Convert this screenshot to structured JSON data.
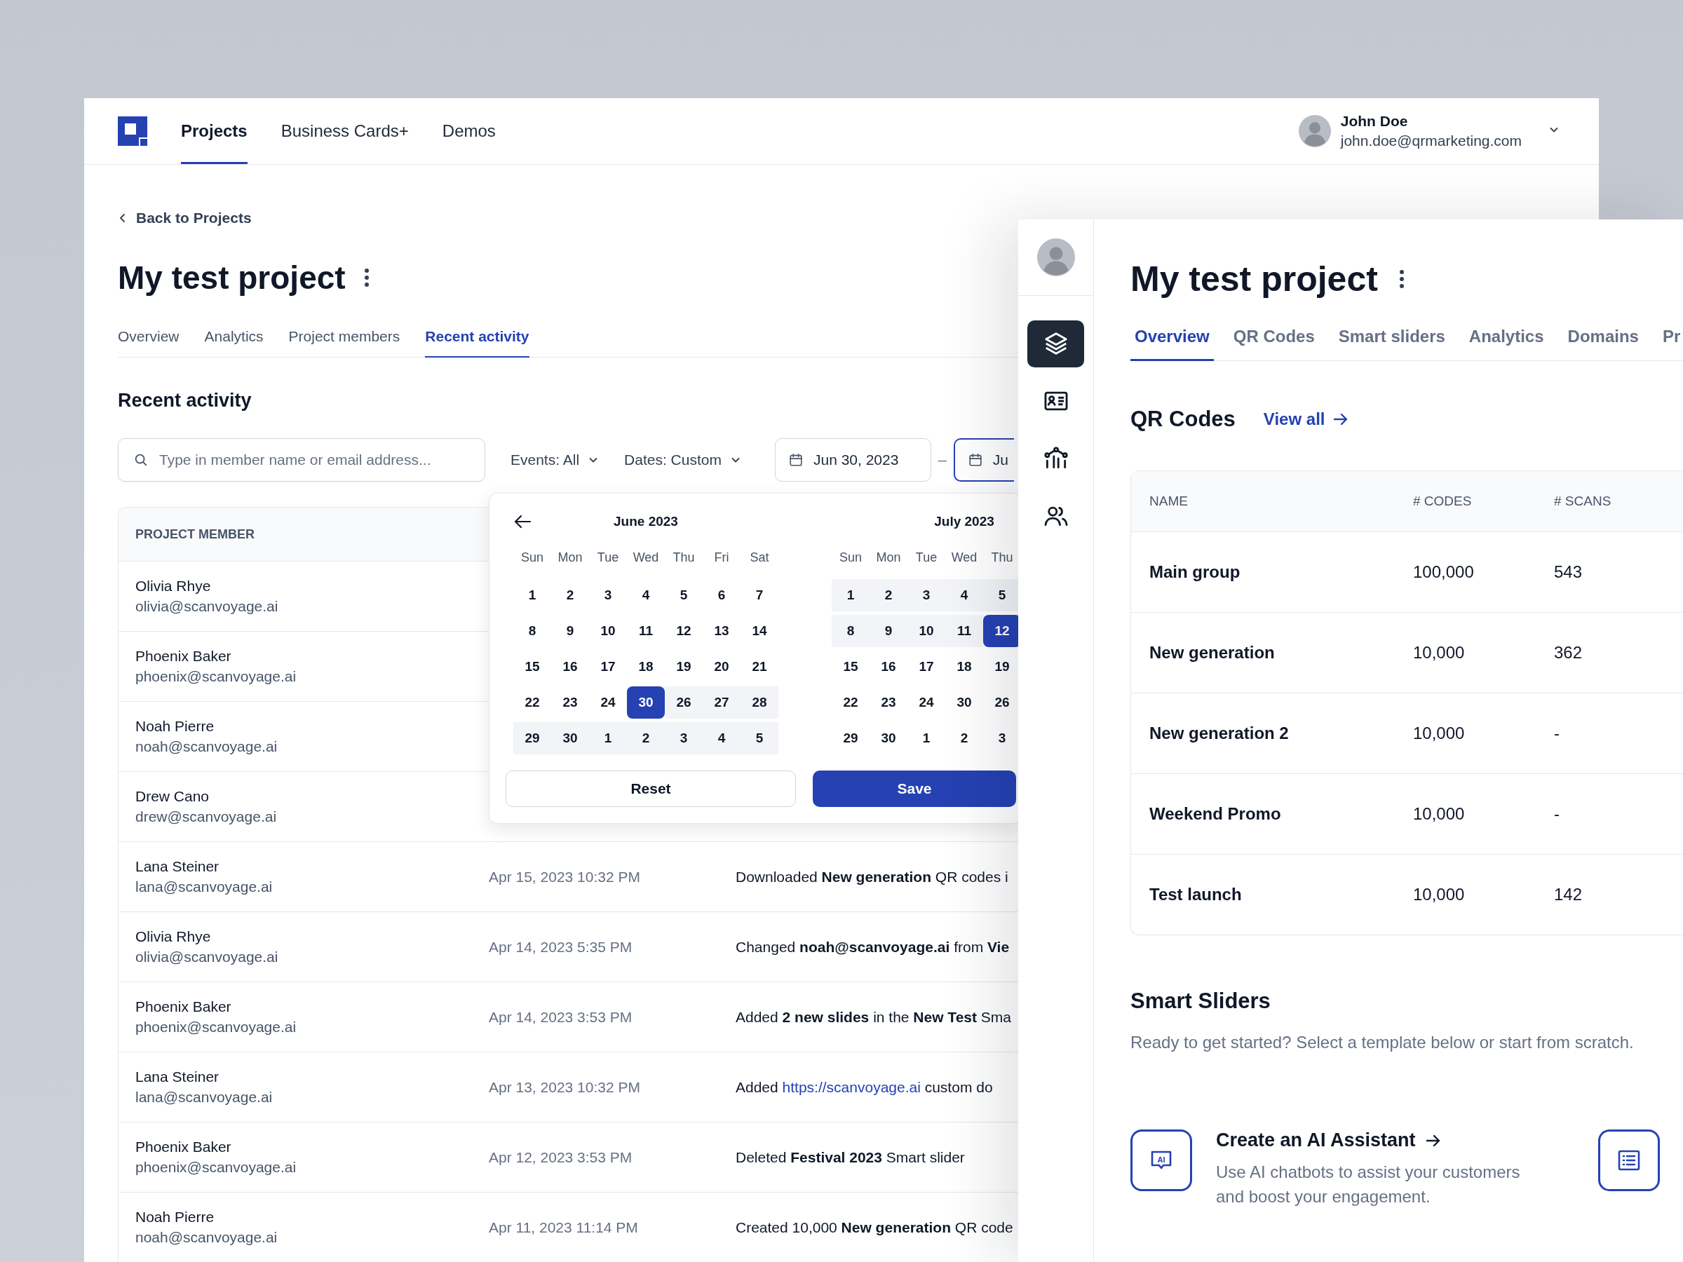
{
  "header": {
    "nav": [
      {
        "label": "Projects",
        "selected": true
      },
      {
        "label": "Business Cards+",
        "selected": false
      },
      {
        "label": "Demos",
        "selected": false
      }
    ],
    "user": {
      "name": "John Doe",
      "email": "john.doe@qrmarketing.com"
    }
  },
  "back_link": "Back to Projects",
  "project": {
    "title": "My test project",
    "tabs": [
      {
        "label": "Overview",
        "selected": false
      },
      {
        "label": "Analytics",
        "selected": false
      },
      {
        "label": "Project members",
        "selected": false
      },
      {
        "label": "Recent activity",
        "selected": true
      }
    ]
  },
  "activity": {
    "heading": "Recent activity",
    "search": {
      "placeholder": "Type in member name or email address..."
    },
    "filters": [
      "Events: All",
      "Dates: Custom"
    ],
    "date_range": [
      {
        "value": "Jun 30, 2023",
        "focused": false
      },
      {
        "value": "Ju",
        "focused": true
      }
    ],
    "separator": "–",
    "columns": [
      "PROJECT MEMBER"
    ],
    "rows": [
      {
        "name": "Olivia Rhye",
        "email": "olivia@scanvoyage.ai"
      },
      {
        "name": "Phoenix Baker",
        "email": "phoenix@scanvoyage.ai"
      },
      {
        "name": "Noah Pierre",
        "email": "noah@scanvoyage.ai"
      },
      {
        "name": "Drew Cano",
        "email": "drew@scanvoyage.ai"
      },
      {
        "name": "Lana Steiner",
        "email": "lana@scanvoyage.ai",
        "date": "Apr 15, 2023 10:32 PM",
        "event": [
          {
            "text": "Downloaded ",
            "kind": "text"
          },
          {
            "text": "New generation",
            "kind": "bold"
          },
          {
            "text": " QR codes i",
            "kind": "text"
          }
        ]
      },
      {
        "name": "Olivia Rhye",
        "email": "olivia@scanvoyage.ai",
        "date": "Apr 14, 2023 5:35 PM",
        "event": [
          {
            "text": "Changed ",
            "kind": "text"
          },
          {
            "text": "noah@scanvoyage.ai",
            "kind": "bold"
          },
          {
            "text": " from ",
            "kind": "text"
          },
          {
            "text": "Vie",
            "kind": "bold"
          }
        ]
      },
      {
        "name": "Phoenix Baker",
        "email": "phoenix@scanvoyage.ai",
        "date": "Apr 14, 2023 3:53 PM",
        "event": [
          {
            "text": "Added ",
            "kind": "text"
          },
          {
            "text": "2 new slides",
            "kind": "bold"
          },
          {
            "text": " in the ",
            "kind": "text"
          },
          {
            "text": "New Test",
            "kind": "bold"
          },
          {
            "text": " Sma",
            "kind": "text"
          }
        ]
      },
      {
        "name": "Lana Steiner",
        "email": "lana@scanvoyage.ai",
        "date": "Apr 13, 2023 10:32 PM",
        "event": [
          {
            "text": "Added ",
            "kind": "text"
          },
          {
            "text": "https://scanvoyage.ai",
            "kind": "link"
          },
          {
            "text": " custom do",
            "kind": "text"
          }
        ]
      },
      {
        "name": "Phoenix Baker",
        "email": "phoenix@scanvoyage.ai",
        "date": "Apr 12, 2023 3:53 PM",
        "event": [
          {
            "text": "Deleted ",
            "kind": "text"
          },
          {
            "text": "Festival 2023",
            "kind": "bold"
          },
          {
            "text": " Smart slider",
            "kind": "text"
          }
        ]
      },
      {
        "name": "Noah Pierre",
        "email": "noah@scanvoyage.ai",
        "date": "Apr 11, 2023 11:14 PM",
        "event": [
          {
            "text": "Created 10,000 ",
            "kind": "text"
          },
          {
            "text": "New generation",
            "kind": "bold"
          },
          {
            "text": " QR code",
            "kind": "text"
          }
        ]
      }
    ]
  },
  "date_picker": {
    "months": [
      {
        "title": "June 2023",
        "weekdays": [
          "Sun",
          "Mon",
          "Tue",
          "Wed",
          "Thu",
          "Fri",
          "Sat"
        ],
        "weeks": [
          [
            {
              "label": "1",
              "selected": false,
              "in_range": false
            },
            {
              "label": "2",
              "selected": false,
              "in_range": false
            },
            {
              "label": "3",
              "selected": false,
              "in_range": false
            },
            {
              "label": "4",
              "selected": false,
              "in_range": false
            },
            {
              "label": "5",
              "selected": false,
              "in_range": false
            },
            {
              "label": "6",
              "selected": false,
              "in_range": false
            },
            {
              "label": "7",
              "selected": false,
              "in_range": false
            }
          ],
          [
            {
              "label": "8",
              "selected": false,
              "in_range": false
            },
            {
              "label": "9",
              "selected": false,
              "in_range": false
            },
            {
              "label": "10",
              "selected": false,
              "in_range": false
            },
            {
              "label": "11",
              "selected": false,
              "in_range": false
            },
            {
              "label": "12",
              "selected": false,
              "in_range": false
            },
            {
              "label": "13",
              "selected": false,
              "in_range": false
            },
            {
              "label": "14",
              "selected": false,
              "in_range": false
            }
          ],
          [
            {
              "label": "15",
              "selected": false,
              "in_range": false
            },
            {
              "label": "16",
              "selected": false,
              "in_range": false
            },
            {
              "label": "17",
              "selected": false,
              "in_range": false
            },
            {
              "label": "18",
              "selected": false,
              "in_range": false
            },
            {
              "label": "19",
              "selected": false,
              "in_range": false
            },
            {
              "label": "20",
              "selected": false,
              "in_range": false
            },
            {
              "label": "21",
              "selected": false,
              "in_range": false
            }
          ],
          [
            {
              "label": "22",
              "selected": false,
              "in_range": false
            },
            {
              "label": "23",
              "selected": false,
              "in_range": false
            },
            {
              "label": "24",
              "selected": false,
              "in_range": false
            },
            {
              "label": "30",
              "selected": true,
              "in_range": false
            },
            {
              "label": "26",
              "selected": false,
              "in_range": true
            },
            {
              "label": "27",
              "selected": false,
              "in_range": true
            },
            {
              "label": "28",
              "selected": false,
              "in_range": true
            }
          ],
          [
            {
              "label": "29",
              "selected": false,
              "in_range": true
            },
            {
              "label": "30",
              "selected": false,
              "in_range": true
            },
            {
              "label": "1",
              "selected": false,
              "in_range": true
            },
            {
              "label": "2",
              "selected": false,
              "in_range": true
            },
            {
              "label": "3",
              "selected": false,
              "in_range": true
            },
            {
              "label": "4",
              "selected": false,
              "in_range": true
            },
            {
              "label": "5",
              "selected": false,
              "in_range": true
            }
          ]
        ]
      },
      {
        "title": "July 2023",
        "weekdays": [
          "Sun",
          "Mon",
          "Tue",
          "Wed",
          "Thu"
        ],
        "weeks": [
          [
            {
              "label": "1",
              "selected": false,
              "in_range": true
            },
            {
              "label": "2",
              "selected": false,
              "in_range": true
            },
            {
              "label": "3",
              "selected": false,
              "in_range": true
            },
            {
              "label": "4",
              "selected": false,
              "in_range": true
            },
            {
              "label": "5",
              "selected": false,
              "in_range": true
            }
          ],
          [
            {
              "label": "8",
              "selected": false,
              "in_range": true
            },
            {
              "label": "9",
              "selected": false,
              "in_range": true
            },
            {
              "label": "10",
              "selected": false,
              "in_range": true
            },
            {
              "label": "11",
              "selected": false,
              "in_range": true
            },
            {
              "label": "12",
              "selected": true,
              "in_range": false
            }
          ],
          [
            {
              "label": "15",
              "selected": false,
              "in_range": false
            },
            {
              "label": "16",
              "selected": false,
              "in_range": false
            },
            {
              "label": "17",
              "selected": false,
              "in_range": false
            },
            {
              "label": "18",
              "selected": false,
              "in_range": false
            },
            {
              "label": "19",
              "selected": false,
              "in_range": false
            }
          ],
          [
            {
              "label": "22",
              "selected": false,
              "in_range": false
            },
            {
              "label": "23",
              "selected": false,
              "in_range": false
            },
            {
              "label": "24",
              "selected": false,
              "in_range": false
            },
            {
              "label": "30",
              "selected": false,
              "in_range": false
            },
            {
              "label": "26",
              "selected": false,
              "in_range": false
            }
          ],
          [
            {
              "label": "29",
              "selected": false,
              "in_range": false
            },
            {
              "label": "30",
              "selected": false,
              "in_range": false
            },
            {
              "label": "1",
              "selected": false,
              "in_range": false
            },
            {
              "label": "2",
              "selected": false,
              "in_range": false
            },
            {
              "label": "3",
              "selected": false,
              "in_range": false
            }
          ]
        ]
      }
    ],
    "buttons": [
      {
        "label": "Reset",
        "kind": "secondary"
      },
      {
        "label": "Save",
        "kind": "primary"
      }
    ]
  },
  "panel": {
    "nav_icons": [
      {
        "kind": "layers",
        "selected": true
      },
      {
        "kind": "id-card",
        "selected": false
      },
      {
        "kind": "chart",
        "selected": false
      },
      {
        "kind": "users",
        "selected": false
      }
    ],
    "title": "My test project",
    "tabs": [
      {
        "label": "Overview",
        "selected": true
      },
      {
        "label": "QR Codes",
        "selected": false
      },
      {
        "label": "Smart sliders",
        "selected": false
      },
      {
        "label": "Analytics",
        "selected": false
      },
      {
        "label": "Domains",
        "selected": false
      },
      {
        "label": "Pr",
        "selected": false
      }
    ],
    "qr_codes": {
      "heading": "QR Codes",
      "view_all": "View all",
      "columns": [
        "NAME",
        "# CODES",
        "# SCANS"
      ],
      "rows": [
        [
          "Main group",
          "100,000",
          "543"
        ],
        [
          "New generation",
          "10,000",
          "362"
        ],
        [
          "New generation 2",
          "10,000",
          "-"
        ],
        [
          "Weekend Promo",
          "10,000",
          "-"
        ],
        [
          "Test launch",
          "10,000",
          "142"
        ]
      ]
    },
    "smart_sliders": {
      "heading": "Smart Sliders",
      "subtitle": "Ready to get started? Select a template below or start from scratch.",
      "templates": [
        {
          "kind": "ai-chat",
          "icon_text": "AI",
          "title": "Create an AI Assistant",
          "description": "Use AI chatbots to assist your customers and boost your engagement."
        },
        {
          "kind": "list"
        }
      ]
    }
  }
}
